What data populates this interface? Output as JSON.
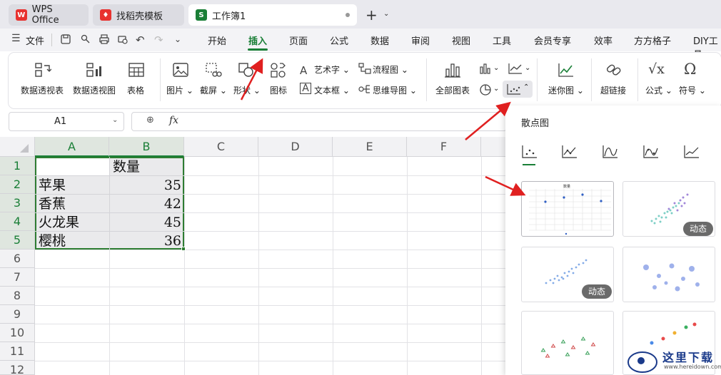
{
  "tabs": [
    {
      "label": "WPS Office",
      "icon": "wps-logo-icon",
      "color": "#e8322f"
    },
    {
      "label": "找稻壳模板",
      "icon": "docer-icon",
      "color": "#e8322f"
    },
    {
      "label": "工作簿1",
      "icon": "sheet-icon",
      "icon_letter": "S",
      "color": "#1a7f37"
    }
  ],
  "new_tab": "+",
  "file_menu": "文件",
  "menu": [
    "开始",
    "插入",
    "页面",
    "公式",
    "数据",
    "审阅",
    "视图",
    "工具",
    "会员专享",
    "效率",
    "方方格子",
    "DIY工具"
  ],
  "active_menu": "插入",
  "ribbon": {
    "pivot_table": "数据透视表",
    "pivot_chart": "数据透视图",
    "table": "表格",
    "picture": "图片",
    "screenshot": "截屏",
    "shapes": "形状",
    "icons": "图标",
    "art_text": "艺术字",
    "text_box": "文本框",
    "flowchart": "流程图",
    "mindmap": "思维导图",
    "all_charts": "全部图表",
    "sparkline": "迷你图",
    "hyperlink": "超链接",
    "formula": "公式",
    "symbol": "符号"
  },
  "formula_bar": {
    "cell_ref": "A1",
    "fx": "fx",
    "value": ""
  },
  "columns": [
    "A",
    "B",
    "C",
    "D",
    "E",
    "F"
  ],
  "rows": [
    "1",
    "2",
    "3",
    "4",
    "5",
    "6",
    "7",
    "8",
    "9",
    "10",
    "11",
    "12"
  ],
  "sheet": {
    "header": "数量",
    "data": [
      {
        "name": "苹果",
        "qty": "35"
      },
      {
        "name": "香蕉",
        "qty": "42"
      },
      {
        "name": "火龙果",
        "qty": "45"
      },
      {
        "name": "樱桃",
        "qty": "36"
      }
    ]
  },
  "panel": {
    "title": "散点图",
    "badge": "动态",
    "thumb1_title": "数量"
  },
  "watermark": {
    "text": "这里下载",
    "url": "www.hereidown.com"
  },
  "colors": {
    "accent": "#1a7f37",
    "arrow": "#e02020",
    "selection": "#2e7d32"
  }
}
